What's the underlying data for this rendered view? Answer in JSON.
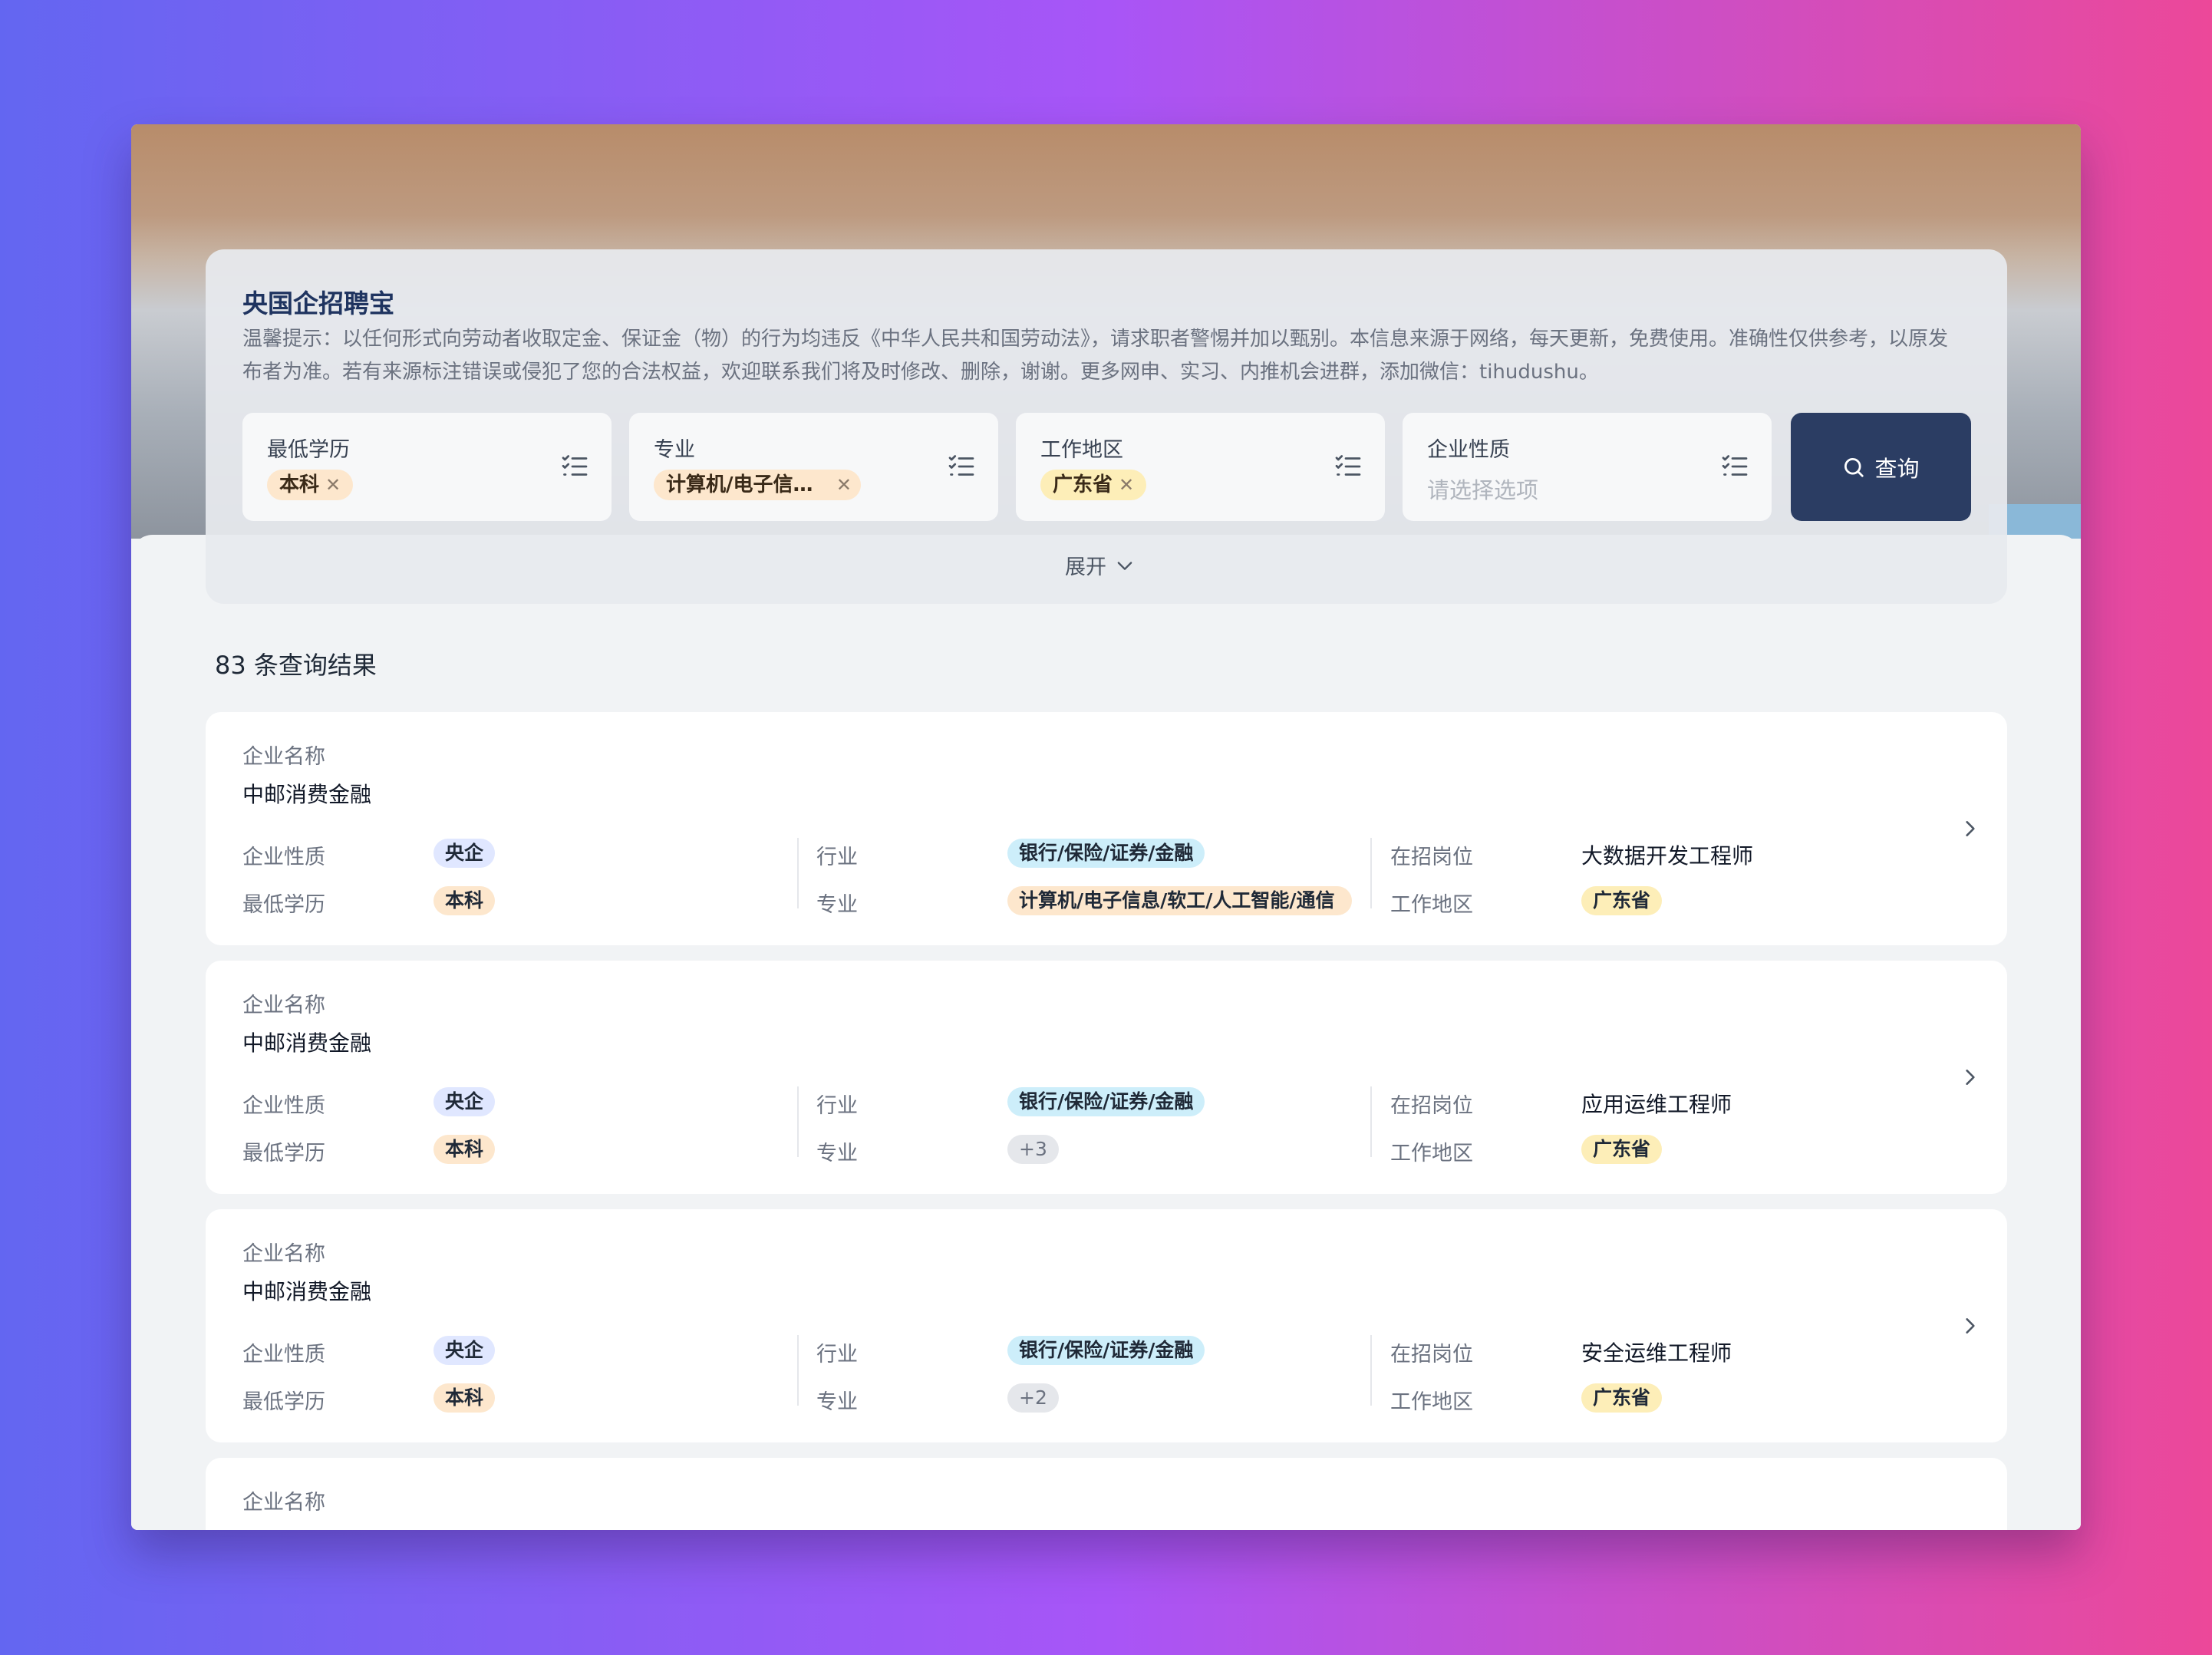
{
  "app": {
    "title": "央国企招聘宝",
    "notice": "温馨提示：以任何形式向劳动者收取定金、保证金（物）的行为均违反《中华人民共和国劳动法》，请求职者警惕并加以甄别。本信息来源于网络，每天更新，免费使用。准确性仅供参考，以原发布者为准。若有来源标注错误或侵犯了您的合法权益，欢迎联系我们将及时修改、删除，谢谢。更多网申、实习、内推机会进群，添加微信：tihudushu。"
  },
  "filters": [
    {
      "label": "最低学历",
      "chip": "本科",
      "placeholder": ""
    },
    {
      "label": "专业",
      "chip": "计算机/电子信息/软工/人工智能/通信",
      "placeholder": ""
    },
    {
      "label": "工作地区",
      "chip": "广东省",
      "placeholder": ""
    },
    {
      "label": "企业性质",
      "chip": "",
      "placeholder": "请选择选项"
    }
  ],
  "query_button": "查询",
  "expand_label": "展开",
  "result_count": "83 条查询结果",
  "field_labels": {
    "company_name": "企业名称",
    "nature": "企业性质",
    "education": "最低学历",
    "industry": "行业",
    "major": "专业",
    "position": "在招岗位",
    "region": "工作地区"
  },
  "results": [
    {
      "company": "中邮消费金融",
      "nature": "央企",
      "education": "本科",
      "industry": "银行/保险/证券/金融",
      "major": "计算机/电子信息/软工/人工智能/通信",
      "position": "大数据开发工程师",
      "region": "广东省"
    },
    {
      "company": "中邮消费金融",
      "nature": "央企",
      "education": "本科",
      "industry": "银行/保险/证券/金融",
      "major": "+3",
      "position": "应用运维工程师",
      "region": "广东省"
    },
    {
      "company": "中邮消费金融",
      "nature": "央企",
      "education": "本科",
      "industry": "银行/保险/证券/金融",
      "major": "+2",
      "position": "安全运维工程师",
      "region": "广东省"
    },
    {
      "company": "",
      "nature": "",
      "education": "",
      "industry": "",
      "major": "",
      "position": "",
      "region": ""
    }
  ],
  "colors": {
    "primary_button": "#2b3d63",
    "title": "#1f3460",
    "tag_nature": "#e0e7ff",
    "tag_education": "#fde7cd",
    "tag_industry": "#cdeefa",
    "tag_region": "#fdeeb8"
  },
  "icons": {
    "filter": "list-check-icon",
    "search": "search-icon",
    "expand": "chevron-down-icon",
    "row": "chevron-right-icon"
  }
}
